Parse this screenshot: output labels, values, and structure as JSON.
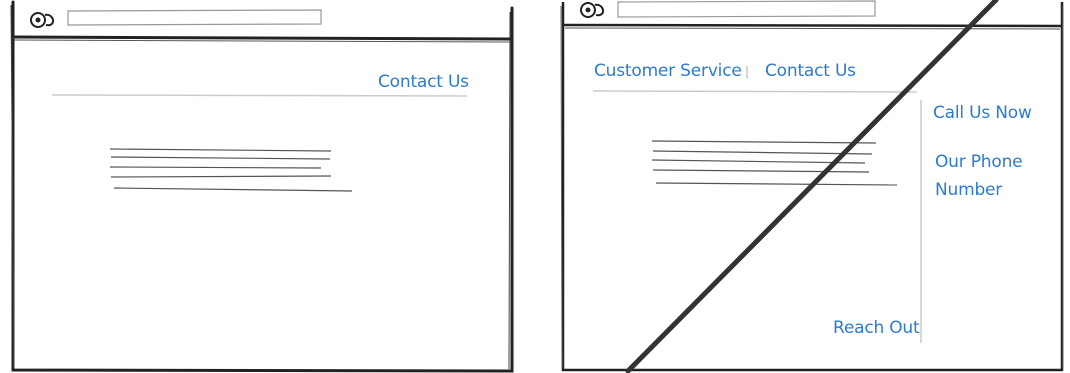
{
  "left_wireframe": {
    "nav": {
      "contact_label": "Contact Us"
    }
  },
  "right_wireframe": {
    "nav": {
      "customer_service_label": "Customer Service",
      "contact_label": "Contact Us"
    },
    "sidebar": {
      "call_label": "Call Us Now",
      "phone_label": "Our Phone Number"
    },
    "footer_link": {
      "reach_out_label": "Reach Out"
    },
    "crossed_out": true
  },
  "colors": {
    "link": "#2b7bd1",
    "ink": "#222222",
    "rule": "#cccccc",
    "text_line": "#555555"
  },
  "icons": [
    "eye-logo-icon",
    "eye-logo-icon"
  ]
}
